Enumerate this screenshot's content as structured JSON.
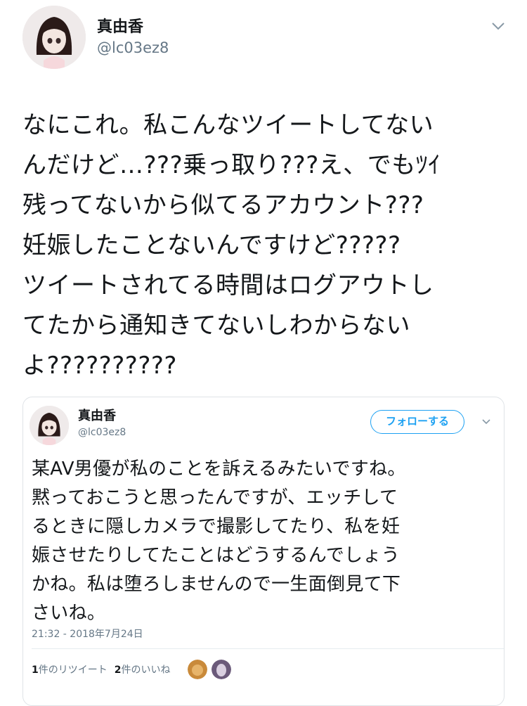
{
  "tweet": {
    "display_name": "真由香",
    "handle": "@lc03ez8",
    "text": "なにこれ。私こんなツイートしてない\nんだけど…???乗っ取り???え、でもﾂｲ\n残ってないから似てるアカウント???\n妊娠したことないんですけど?????\nツイートされてる時間はログアウトし\nてたから通知きてないしわからない\nよ??????????"
  },
  "quoted_screenshot": {
    "display_name": "真由香",
    "handle": "@lc03ez8",
    "follow_label": "フォローする",
    "text": "某AV男優が私のことを訴えるみたいですね。\n黙っておこうと思ったんですが、エッチして\nるときに隠しカメラで撮影してたり、私を妊\n娠させたりしてたことはどうするんでしょう\nかね。私は堕ろしませんので一生面倒見て下\nさいね。",
    "timestamp": "21:32 - 2018年7月24日",
    "retweets_count": "1",
    "retweets_label": "件のリツイート",
    "likes_count": "2",
    "likes_label": "件のいいね"
  },
  "colors": {
    "accent": "#1da1f2",
    "secondary_text": "#657786"
  }
}
